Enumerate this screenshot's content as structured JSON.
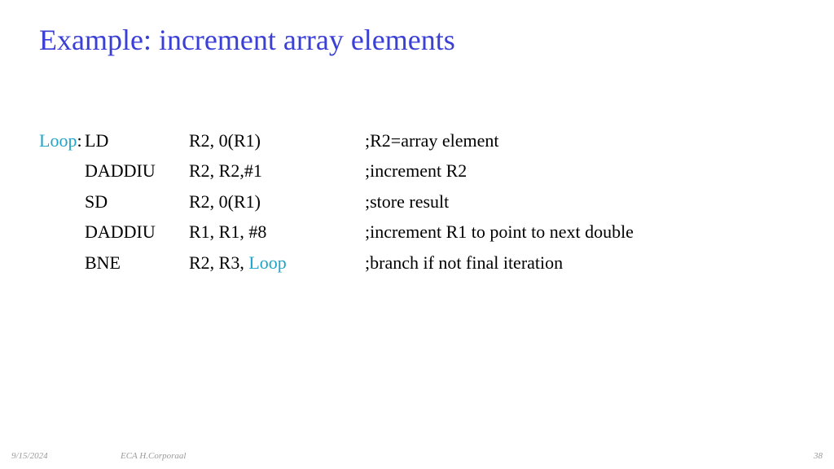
{
  "title": "Example: increment array elements",
  "label_name": "Loop",
  "rows": [
    {
      "label": "Loop",
      "op": "LD",
      "args_pre": "R2, 0(R1)",
      "args_link": "",
      "comment": ";R2=array element"
    },
    {
      "label": "",
      "op": "DADDIU",
      "args_pre": "R2, R2,#1",
      "args_link": "",
      "comment": ";increment R2"
    },
    {
      "label": "",
      "op": "SD",
      "args_pre": "R2, 0(R1)",
      "args_link": "",
      "comment": ";store result"
    },
    {
      "label": "",
      "op": "DADDIU",
      "args_pre": "R1, R1, #8",
      "args_link": "",
      "comment": ";increment R1 to point to next double"
    },
    {
      "label": "",
      "op": "BNE",
      "args_pre": "R2, R3, ",
      "args_link": "Loop",
      "comment": ";branch if not final iteration"
    }
  ],
  "footer": {
    "date": "9/15/2024",
    "center": "ECA  H.Corporaal",
    "page": "38"
  }
}
